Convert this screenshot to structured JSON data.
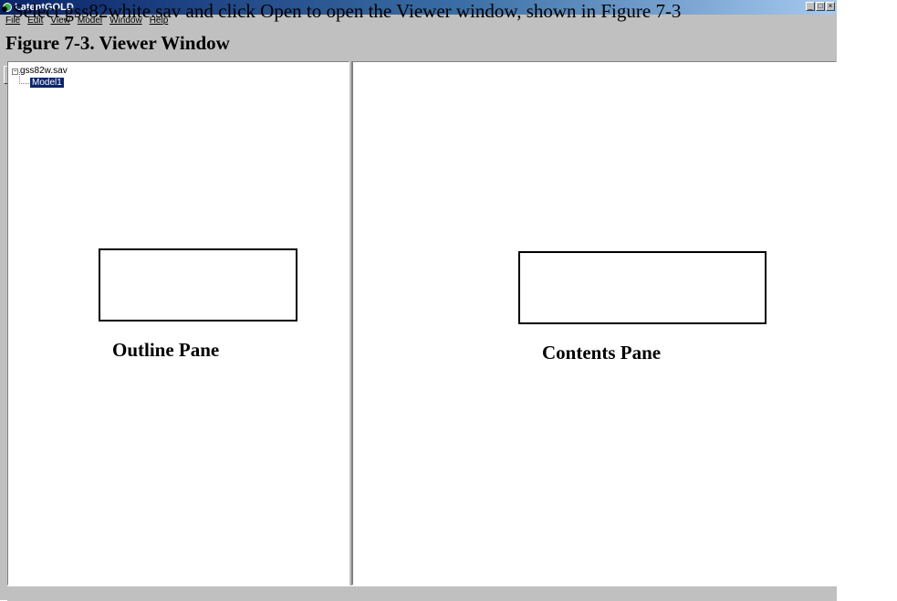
{
  "window": {
    "title": "LatentGOLD",
    "buttons": [
      "_",
      "□",
      "×"
    ]
  },
  "menu": [
    "File",
    "Edit",
    "View",
    "Model",
    "Window",
    "Help"
  ],
  "toolbar": {
    "icons": [
      "open-icon",
      "save-icon",
      "print-icon",
      "copy-icon",
      "run-icon",
      "stop-icon",
      "help-icon"
    ]
  },
  "outline_tree": {
    "root": "gss82w.sav",
    "expander": "−",
    "child": "Model1"
  },
  "annotations": {
    "outline_label": "Outline Pane",
    "contents_label": "Contents Pane"
  },
  "document": {
    "instruction": "Select gss82white.sav and click Open to open the Viewer window, shown in Figure 7-3",
    "caption": "Figure 7-3. Viewer Window"
  }
}
